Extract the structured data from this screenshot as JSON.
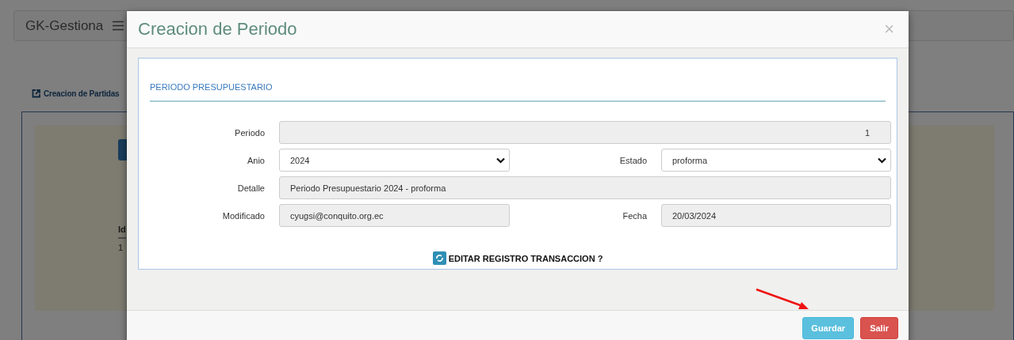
{
  "background": {
    "brand": "GK-Gestiona",
    "tab": "Creacion de Partidas",
    "table": {
      "columns": [
        "Id"
      ],
      "rows": [
        [
          "1"
        ]
      ]
    }
  },
  "modal": {
    "title": "Creacion de Periodo",
    "close": "×",
    "section": "PERIODO PRESUPUESTARIO",
    "rows": [
      [
        {
          "label": "Periodo",
          "kind": "number",
          "value": "1"
        }
      ],
      [
        {
          "label": "Anio",
          "kind": "select",
          "value": "2024"
        },
        {
          "label": "Estado",
          "kind": "select",
          "value": "proforma"
        }
      ],
      [
        {
          "label": "Detalle",
          "kind": "text",
          "value": "Periodo Presupuestario 2024 - proforma"
        }
      ],
      [
        {
          "label": "Modificado",
          "kind": "text",
          "value": "cyugsi@conquito.org.ec"
        },
        {
          "label": "Fecha",
          "kind": "text",
          "value": "20/03/2024"
        }
      ]
    ],
    "action": "EDITAR REGISTRO TRANSACCION ?",
    "buttons": [
      {
        "label": "Guardar",
        "kind": "primary"
      },
      {
        "label": "Salir",
        "kind": "danger"
      }
    ]
  }
}
